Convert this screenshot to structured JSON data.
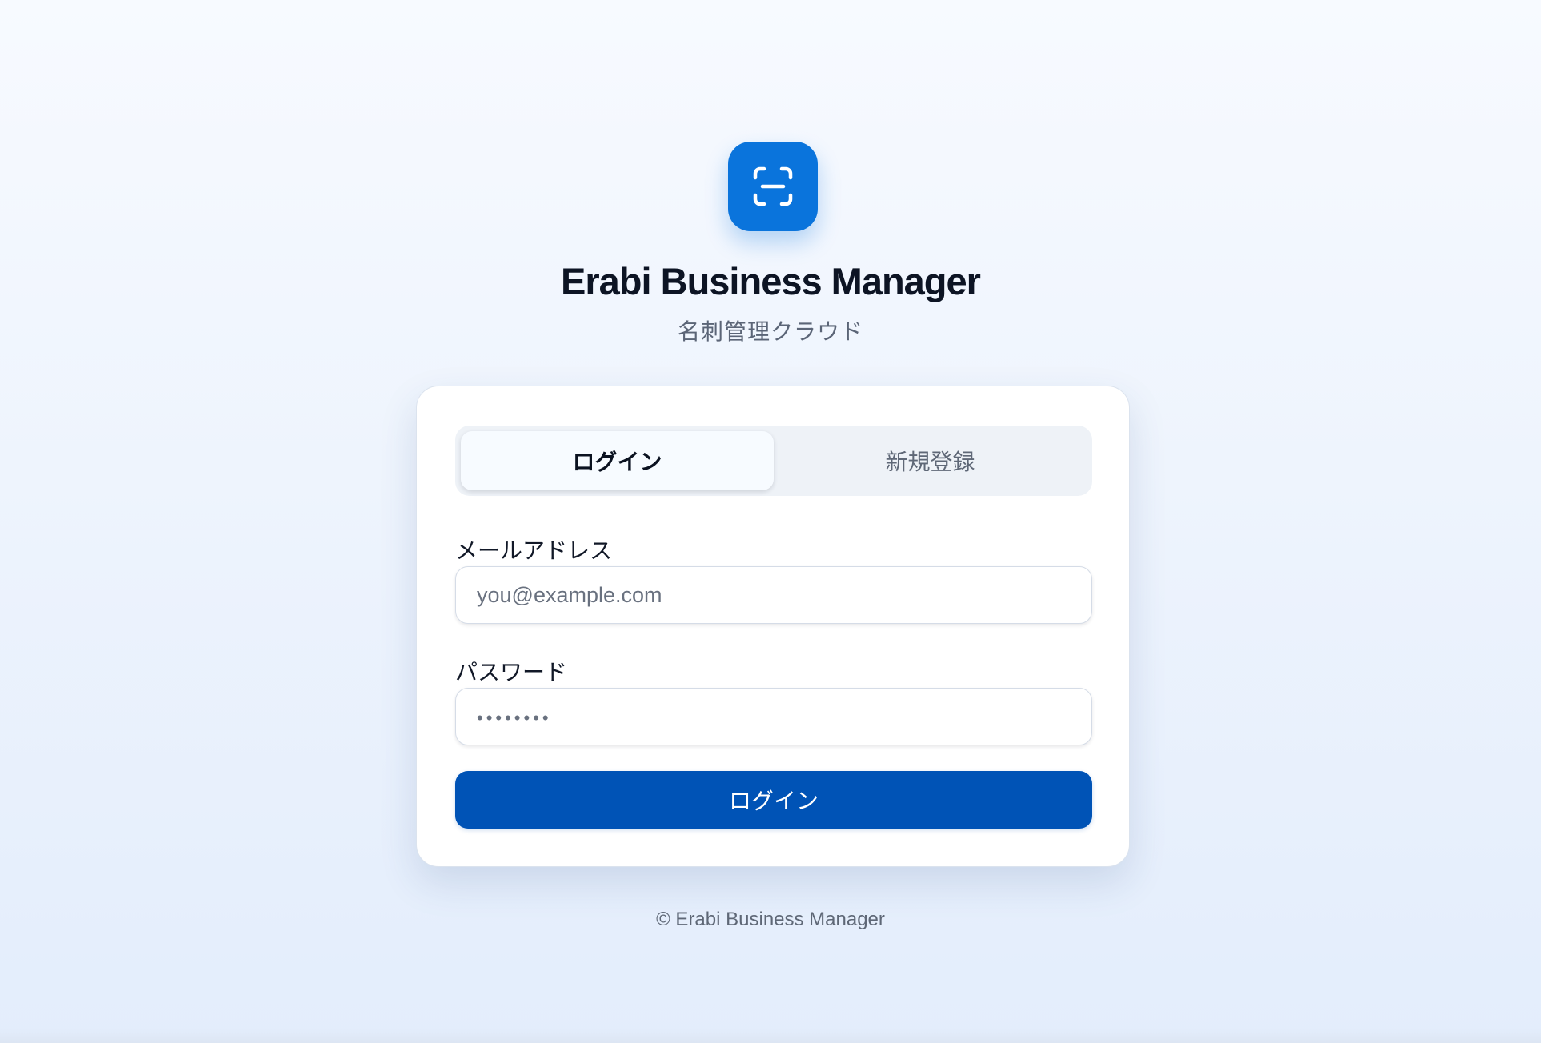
{
  "brand": {
    "logo_icon": "scan-icon",
    "accent_color": "#0a74dc",
    "title": "Erabi Business Manager",
    "subtitle": "名刺管理クラウド"
  },
  "auth": {
    "tabs": [
      {
        "label": "ログイン",
        "active": true
      },
      {
        "label": "新規登録",
        "active": false
      }
    ],
    "email": {
      "label": "メールアドレス",
      "placeholder": "you@example.com",
      "value": ""
    },
    "password": {
      "label": "パスワード",
      "placeholder": "••••••••",
      "value": ""
    },
    "submit_label": "ログイン",
    "submit_color": "#0053b6"
  },
  "footer": {
    "text": "© Erabi Business Manager"
  }
}
